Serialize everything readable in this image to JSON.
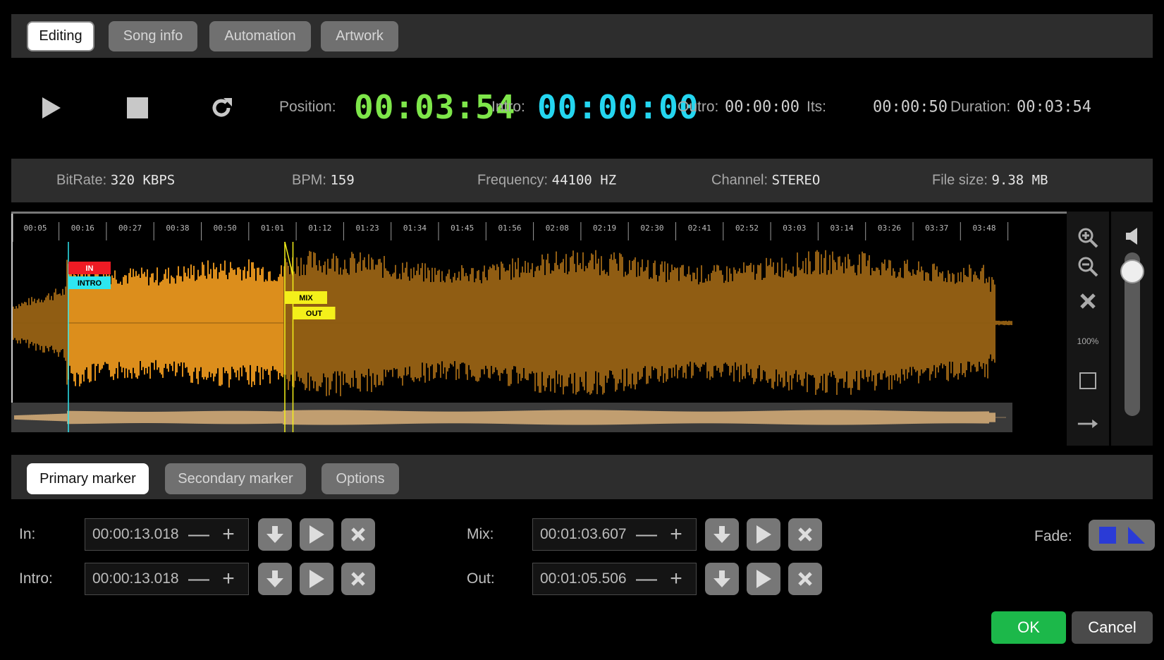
{
  "tabs": [
    {
      "label": "Editing",
      "active": true
    },
    {
      "label": "Song info"
    },
    {
      "label": "Automation"
    },
    {
      "label": "Artwork"
    }
  ],
  "transport": {
    "position_label": "Position:",
    "position_value": "00:03:54",
    "intro_label": "Intro:",
    "intro_value": "00:00:00",
    "outro_label": "Outro:",
    "outro_value": "00:00:00",
    "its_label": "Its:",
    "its_value": "00:00:50",
    "duration_label": "Duration:",
    "duration_value": "00:03:54"
  },
  "info": {
    "bitrate_label": "BitRate:",
    "bitrate_value": "320 KBPS",
    "bpm_label": "BPM:",
    "bpm_value": "159",
    "frequency_label": "Frequency:",
    "frequency_value": "44100 HZ",
    "channel_label": "Channel:",
    "channel_value": "STEREO",
    "filesize_label": "File size:",
    "filesize_value": "9.38 MB"
  },
  "timeline": {
    "ticks": [
      "00:05",
      "00:16",
      "00:27",
      "00:38",
      "00:50",
      "01:01",
      "01:12",
      "01:23",
      "01:34",
      "01:45",
      "01:56",
      "02:08",
      "02:19",
      "02:30",
      "02:41",
      "02:52",
      "03:03",
      "03:14",
      "03:26",
      "03:37",
      "03:48"
    ]
  },
  "waveform": {
    "duration_s": 234,
    "markers": [
      {
        "label": "IN",
        "time_s": 13.018,
        "color": "#ee1b24"
      },
      {
        "label": "INTRO",
        "time_s": 13.018,
        "color": "#2ee6f0"
      },
      {
        "label": "MIX",
        "time_s": 63.607,
        "color": "#f4f01a"
      },
      {
        "label": "OUT",
        "time_s": 65.506,
        "color": "#f4f01a"
      }
    ]
  },
  "zoom": {
    "level": "100%"
  },
  "volume": {
    "level": 0.95
  },
  "marker_tabs": [
    {
      "label": "Primary marker",
      "active": true
    },
    {
      "label": "Secondary marker"
    },
    {
      "label": "Options"
    }
  ],
  "markers_form": {
    "in_label": "In:",
    "in_value": "00:00:13.018",
    "intro_label": "Intro:",
    "intro_value": "00:00:13.018",
    "mix_label": "Mix:",
    "mix_value": "00:01:03.607",
    "out_label": "Out:",
    "out_value": "00:01:05.506",
    "minus": "—",
    "plus": "+"
  },
  "fade": {
    "label": "Fade:"
  },
  "buttons": {
    "ok": "OK",
    "cancel": "Cancel"
  },
  "colors": {
    "position_time": "#7ee64a",
    "intro_time": "#24d6f0",
    "waveform": "#e8961e",
    "ok_button": "#1cb84a"
  }
}
